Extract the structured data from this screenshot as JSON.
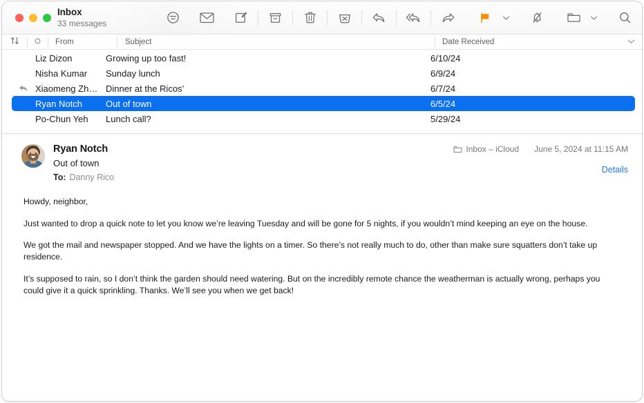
{
  "window": {
    "traffic_lights": [
      "close",
      "minimize",
      "zoom"
    ],
    "colors": {
      "close": "#ff6159",
      "minimize": "#ffbd2e",
      "zoom": "#2bc840",
      "selection": "#0a70f0",
      "link": "#1f7ae8",
      "flag": "#f59000"
    }
  },
  "mailbox": {
    "name": "Inbox",
    "message_count": "33 messages"
  },
  "toolbar": {
    "buttons": [
      {
        "name": "filter-icon",
        "label": "Filter"
      },
      {
        "name": "mail-icon",
        "label": "Get Mail"
      },
      {
        "name": "compose-icon",
        "label": "New Message"
      },
      {
        "name": "archive-icon",
        "label": "Archive"
      },
      {
        "name": "trash-icon",
        "label": "Delete"
      },
      {
        "name": "junk-icon",
        "label": "Move to Junk"
      },
      {
        "name": "reply-icon",
        "label": "Reply"
      },
      {
        "name": "reply-all-icon",
        "label": "Reply All"
      },
      {
        "name": "forward-icon",
        "label": "Forward"
      },
      {
        "name": "flag-icon",
        "label": "Flag"
      },
      {
        "name": "flag-chevron-icon",
        "label": "Flag Options"
      },
      {
        "name": "mute-bell-icon",
        "label": "Mute"
      },
      {
        "name": "folder-icon",
        "label": "Move To"
      },
      {
        "name": "folder-chevron-icon",
        "label": "Move To Options"
      },
      {
        "name": "search-icon",
        "label": "Search"
      }
    ]
  },
  "list": {
    "columns": {
      "sort": "sort-icon",
      "unread": "unread-circle-icon",
      "from": "From",
      "subject": "Subject",
      "date": "Date Received",
      "date_chevron": "chevron-down-icon"
    },
    "rows": [
      {
        "flag": "",
        "from": "Liz Dizon",
        "subject": "Growing up too fast!",
        "date": "6/10/24",
        "selected": false
      },
      {
        "flag": "",
        "from": "Nisha Kumar",
        "subject": "Sunday lunch",
        "date": "6/9/24",
        "selected": false
      },
      {
        "flag": "replied",
        "from": "Xiaomeng Zh…",
        "subject": "Dinner at the Ricos’",
        "date": "6/7/24",
        "selected": false
      },
      {
        "flag": "",
        "from": "Ryan Notch",
        "subject": "Out of town",
        "date": "6/5/24",
        "selected": true
      },
      {
        "flag": "",
        "from": "Po-Chun Yeh",
        "subject": "Lunch call?",
        "date": "5/29/24",
        "selected": false
      },
      {
        "flag": "",
        "from": "",
        "subject": "",
        "date": "",
        "selected": false
      }
    ]
  },
  "message": {
    "sender": "Ryan Notch",
    "subject": "Out of town",
    "to_label": "To:",
    "to_value": "Danny Rico",
    "mailbox": "Inbox – iCloud",
    "date": "June 5, 2024 at 11:15 AM",
    "details_link": "Details",
    "body": [
      "Howdy, neighbor,",
      "Just wanted to drop a quick note to let you know we’re leaving Tuesday and will be gone for 5 nights, if you wouldn’t mind keeping an eye on the house.",
      "We got the mail and newspaper stopped. And we have the lights on a timer. So there’s not really much to do, other than make sure squatters don’t take up residence.",
      "It’s supposed to rain, so I don’t think the garden should need watering. But on the incredibly remote chance the weatherman is actually wrong, perhaps you could give it a quick sprinkling. Thanks. We’ll see you when we get back!"
    ]
  }
}
